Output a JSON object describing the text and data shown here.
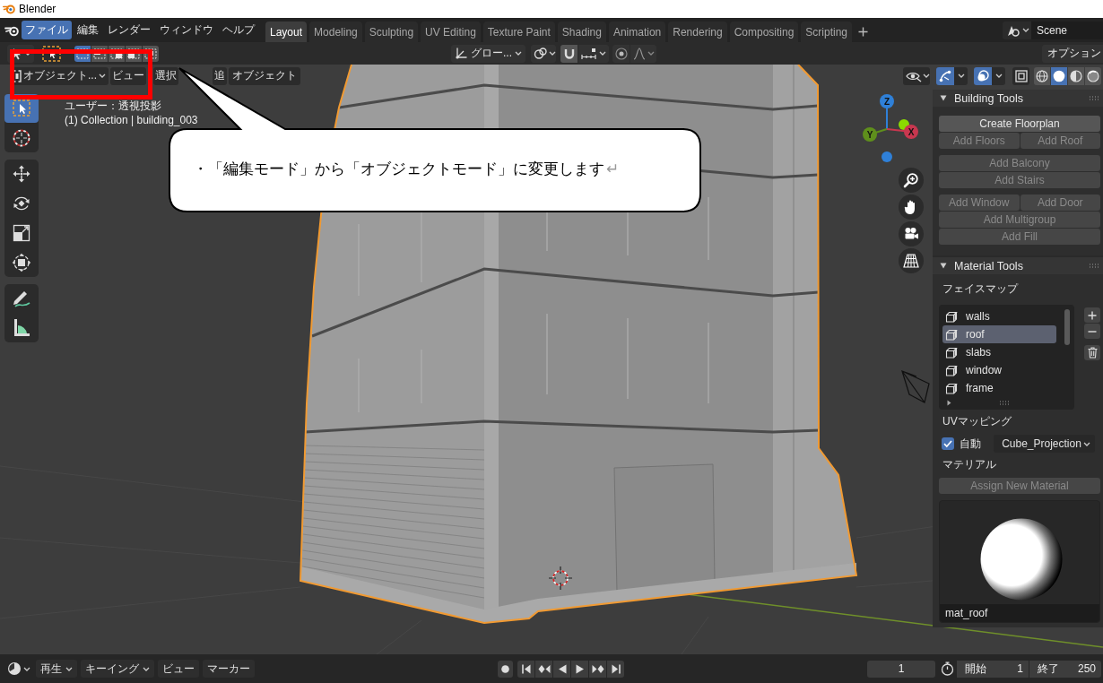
{
  "title_bar": {
    "title": "Blender"
  },
  "menu_bar": {
    "menus": [
      {
        "label": "ファイル",
        "selected": true
      },
      {
        "label": "編集",
        "selected": false
      },
      {
        "label": "レンダー",
        "selected": false
      },
      {
        "label": "ウィンドウ",
        "selected": false
      },
      {
        "label": "ヘルプ",
        "selected": false
      }
    ],
    "workspaces": [
      {
        "label": "Layout",
        "selected": true
      },
      {
        "label": "Modeling",
        "selected": false
      },
      {
        "label": "Sculpting",
        "selected": false
      },
      {
        "label": "UV Editing",
        "selected": false
      },
      {
        "label": "Texture Paint",
        "selected": false
      },
      {
        "label": "Shading",
        "selected": false
      },
      {
        "label": "Animation",
        "selected": false
      },
      {
        "label": "Rendering",
        "selected": false
      },
      {
        "label": "Compositing",
        "selected": false
      },
      {
        "label": "Scripting",
        "selected": false
      }
    ],
    "scene": "Scene"
  },
  "tool_settings": {
    "select_modes": [
      {
        "kind": "set",
        "selected": true
      },
      {
        "kind": "extend",
        "selected": false
      },
      {
        "kind": "subtract",
        "selected": false
      },
      {
        "kind": "difference",
        "selected": false
      },
      {
        "kind": "intersect",
        "selected": false
      }
    ],
    "orientation": "グロー...",
    "options": "オプション"
  },
  "viewport_header": {
    "mode": "オブジェクト...",
    "menus": [
      "ビュー",
      "選択",
      "追",
      "オブジェクト"
    ],
    "show_gizmos": true,
    "show_overlays": true,
    "xray": false,
    "shading_modes": [
      {
        "kind": "wireframe",
        "selected": false
      },
      {
        "kind": "solid",
        "selected": true
      },
      {
        "kind": "material",
        "selected": false
      },
      {
        "kind": "rendered",
        "selected": false
      }
    ]
  },
  "viewport": {
    "view_name": "ユーザー：透視投影",
    "collection": "(1) Collection | building_003",
    "tool_groups": [
      [
        {
          "kind": "select_box",
          "selected": true
        },
        {
          "kind": "cursor",
          "selected": false
        }
      ],
      [
        {
          "kind": "move",
          "selected": false
        },
        {
          "kind": "rotate",
          "selected": false
        },
        {
          "kind": "scale",
          "selected": false
        },
        {
          "kind": "transform",
          "selected": false
        }
      ],
      [
        {
          "kind": "annotate",
          "selected": false
        },
        {
          "kind": "measure",
          "selected": false
        }
      ]
    ],
    "axis_labels": [
      "Z",
      "Y",
      "X"
    ]
  },
  "sidebar": {
    "building_tools": {
      "title": "Building Tools",
      "groups": [
        [
          [
            {
              "label": "Create Floorplan",
              "disabled": false
            }
          ],
          [
            {
              "label": "Add Floors",
              "disabled": true
            },
            {
              "label": "Add Roof",
              "disabled": true
            }
          ]
        ],
        [
          [
            {
              "label": "Add Balcony",
              "disabled": true
            }
          ],
          [
            {
              "label": "Add Stairs",
              "disabled": true
            }
          ]
        ],
        [
          [
            {
              "label": "Add Window",
              "disabled": true
            },
            {
              "label": "Add Door",
              "disabled": true
            }
          ],
          [
            {
              "label": "Add Multigroup",
              "disabled": true
            }
          ],
          [
            {
              "label": "Add Fill",
              "disabled": true
            }
          ]
        ]
      ]
    },
    "material_tools": {
      "title": "Material Tools",
      "face_maps_label": "フェイスマップ",
      "face_maps": [
        {
          "name": "walls",
          "selected": false
        },
        {
          "name": "roof",
          "selected": true
        },
        {
          "name": "slabs",
          "selected": false
        },
        {
          "name": "window",
          "selected": false
        },
        {
          "name": "frame",
          "selected": false
        }
      ],
      "uv_label": "UVマッピング",
      "auto": {
        "label": "自動",
        "checked": true
      },
      "projection": "Cube_Projection",
      "material_label": "マテリアル",
      "assign": {
        "label": "Assign New Material",
        "disabled": true
      },
      "preview_name": "mat_roof"
    }
  },
  "timeline": {
    "menus": [
      {
        "label": "再生",
        "dropdown": true
      },
      {
        "label": "キーイング",
        "dropdown": true
      },
      {
        "label": "ビュー",
        "dropdown": false
      },
      {
        "label": "マーカー",
        "dropdown": false
      }
    ],
    "current_frame": "1",
    "start": {
      "label": "開始",
      "value": "1"
    },
    "end": {
      "label": "終了",
      "value": "250"
    }
  },
  "annotation": {
    "text": "・「編集モード」から「オブジェクトモード」に変更します",
    "return_mark": "↵"
  }
}
